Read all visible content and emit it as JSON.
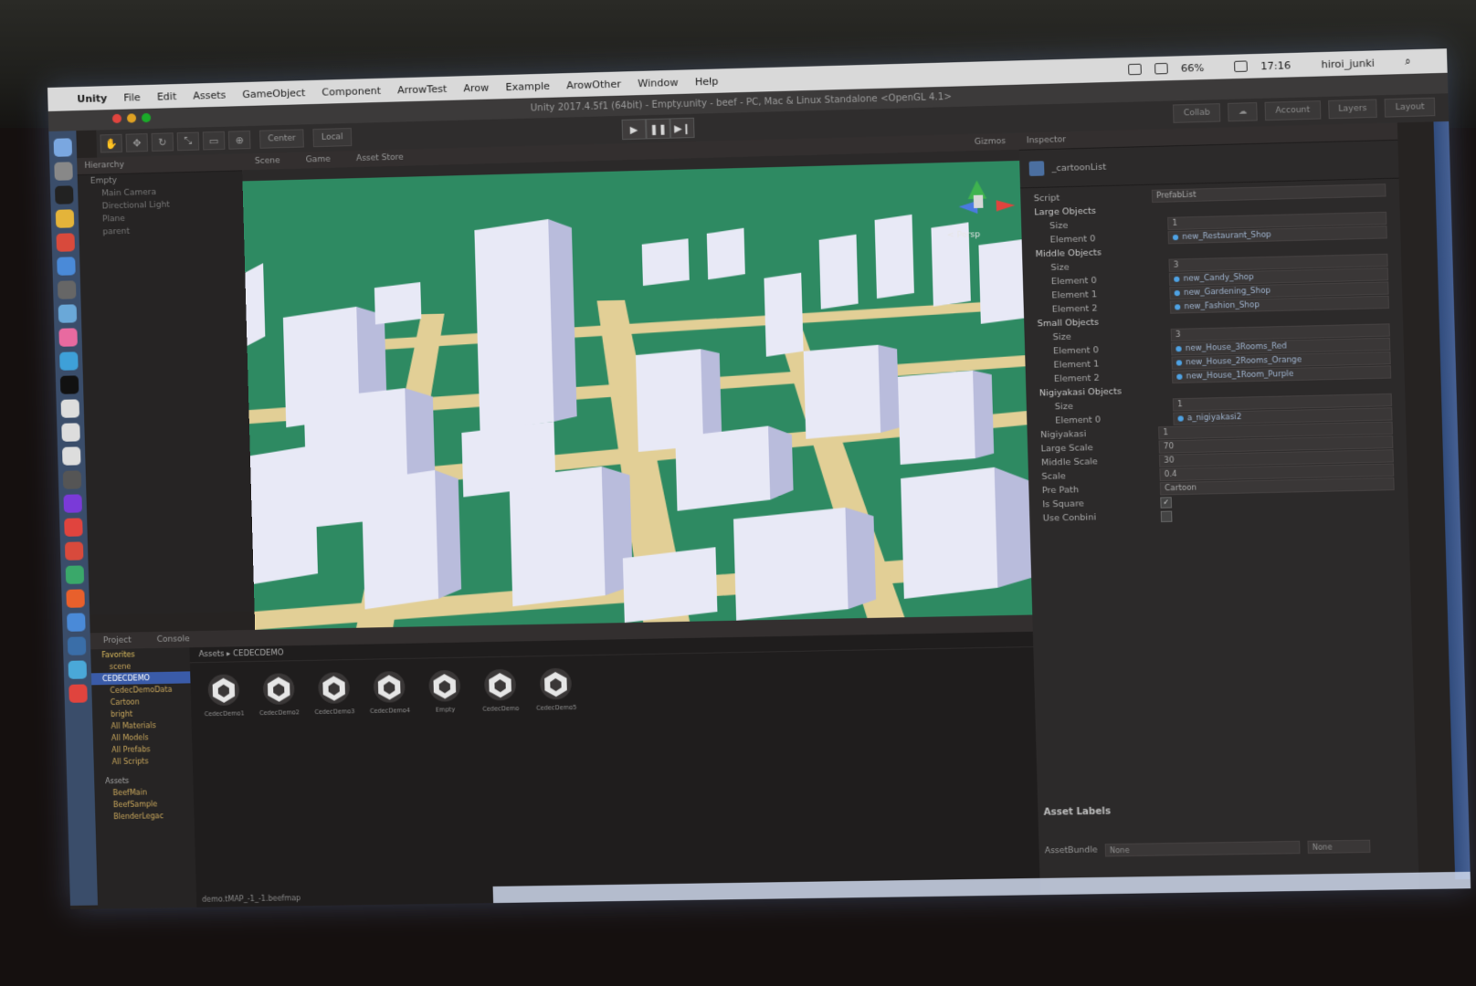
{
  "menubar": {
    "apple": "",
    "items": [
      "Unity",
      "File",
      "Edit",
      "Assets",
      "GameObject",
      "Component",
      "ArrowTest",
      "Arow",
      "Example",
      "ArowOther",
      "Window",
      "Help"
    ],
    "battery": "66%",
    "clock": "17:16",
    "user": "hiroi_junki"
  },
  "title": "Unity 2017.4.5f1 (64bit) - Empty.unity - beef - PC, Mac & Linux Standalone <OpenGL 4.1>",
  "toolbar": {
    "pivot_label": "Center",
    "space_label": "Local",
    "right": {
      "collab": "Collab",
      "account": "Account",
      "layers": "Layers",
      "layout": "Layout"
    }
  },
  "hierarchy": {
    "tab": "Hierarchy",
    "root": "Empty",
    "children": [
      "Main Camera",
      "Directional Light",
      "Plane",
      "parent"
    ]
  },
  "scene": {
    "tabs": [
      "Scene",
      "Game",
      "Asset Store"
    ],
    "persp": "< Persp",
    "gizmo_label": "Gizmos"
  },
  "inspector": {
    "tab": "Inspector",
    "object_name": "_cartoonList",
    "script_label": "Script",
    "script_value": "PrefabList",
    "rows": [
      {
        "label": "Large Objects",
        "type": "header"
      },
      {
        "label": "Size",
        "value": "1",
        "type": "field"
      },
      {
        "label": "Element 0",
        "value": "new_Restaurant_Shop",
        "type": "ref"
      },
      {
        "label": "Middle Objects",
        "type": "header"
      },
      {
        "label": "Size",
        "value": "3",
        "type": "field"
      },
      {
        "label": "Element 0",
        "value": "new_Candy_Shop",
        "type": "ref"
      },
      {
        "label": "Element 1",
        "value": "new_Gardening_Shop",
        "type": "ref"
      },
      {
        "label": "Element 2",
        "value": "new_Fashion_Shop",
        "type": "ref"
      },
      {
        "label": "Small Objects",
        "type": "header"
      },
      {
        "label": "Size",
        "value": "3",
        "type": "field"
      },
      {
        "label": "Element 0",
        "value": "new_House_3Rooms_Red",
        "type": "ref"
      },
      {
        "label": "Element 1",
        "value": "new_House_2Rooms_Orange",
        "type": "ref"
      },
      {
        "label": "Element 2",
        "value": "new_House_1Room_Purple",
        "type": "ref"
      },
      {
        "label": "Nigiyakasi Objects",
        "type": "header"
      },
      {
        "label": "Size",
        "value": "1",
        "type": "field"
      },
      {
        "label": "Element 0",
        "value": "a_nigiyakasi2",
        "type": "ref"
      },
      {
        "label": "Nigiyakasi",
        "value": "1",
        "type": "top"
      },
      {
        "label": "Large Scale",
        "value": "70",
        "type": "top"
      },
      {
        "label": "Middle Scale",
        "value": "30",
        "type": "top"
      },
      {
        "label": "Scale",
        "value": "0.4",
        "type": "top"
      },
      {
        "label": "Pre Path",
        "value": "Cartoon",
        "type": "top"
      },
      {
        "label": "Is Square",
        "value": "✓",
        "type": "check"
      },
      {
        "label": "Use Conbini",
        "value": "",
        "type": "check"
      }
    ],
    "asset_labels": "Asset Labels",
    "asset_bundle_label": "AssetBundle",
    "asset_bundle_value": "None",
    "asset_variant_value": "None"
  },
  "project": {
    "tabs": [
      "Project",
      "Console"
    ],
    "favorites_label": "Favorites",
    "tree": [
      "scene",
      "CEDECDEMO",
      "CedecDemoData",
      "Cartoon",
      "bright",
      "All Materials",
      "All Models",
      "All Prefabs",
      "All Scripts"
    ],
    "assets_label": "Assets",
    "asset_folders": [
      "BeefMain",
      "BeefSample",
      "BlenderLegac"
    ],
    "path": "Assets ▸ CEDECDEMO",
    "assets": [
      "CedecDemo1",
      "CedecDemo2",
      "CedecDemo3",
      "CedecDemo4",
      "Empty",
      "CedecDemo",
      "CedecDemo5"
    ],
    "status": "demo.tMAP_-1_-1.beefmap"
  },
  "colors": {
    "ground": "#2e8a62",
    "road": "#e2cf96",
    "building": "#e8e9f6",
    "building_shade": "#b9bcdc",
    "selection": "#3a5ba8"
  }
}
